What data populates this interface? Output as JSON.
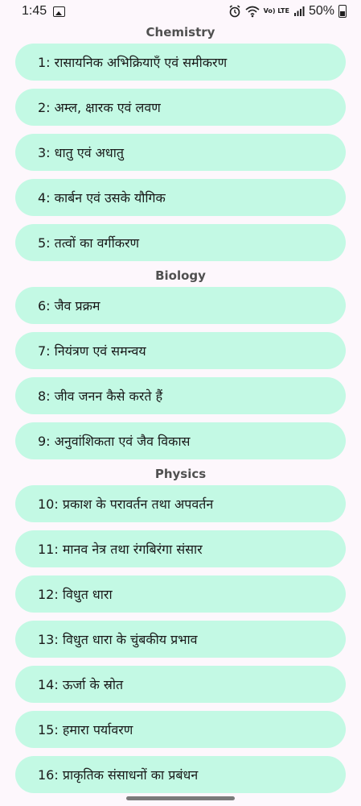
{
  "status_bar": {
    "time": "1:45",
    "network": "Vo) LTE",
    "battery": "50%"
  },
  "sections": [
    {
      "title": "Chemistry",
      "items": [
        "1: रासायनिक अभिक्रियाएँ एवं समीकरण",
        "2: अम्ल, क्षारक एवं लवण",
        "3: धातु एवं अधातु",
        "4: कार्बन एवं उसके यौगिक",
        "5: तत्वों का वर्गीकरण"
      ]
    },
    {
      "title": "Biology",
      "items": [
        "6: जैव प्रक्रम",
        "7: नियंत्रण एवं समन्वय",
        "8: जीव जनन कैसे करते हैं",
        "9: अनुवांशिकता एवं जैव विकास"
      ]
    },
    {
      "title": "Physics",
      "items": [
        "10: प्रकाश के परावर्तन तथा अपवर्तन",
        "11: मानव नेत्र तथा रंगबिरंगा संसार",
        "12: विधुत धारा",
        "13: विधुत धारा के चुंबकीय प्रभाव",
        "14: ऊर्जा के स्रोत",
        "15: हमारा पर्यावरण",
        "16: प्राकृतिक संसाधनों का प्रबंधन"
      ]
    }
  ]
}
